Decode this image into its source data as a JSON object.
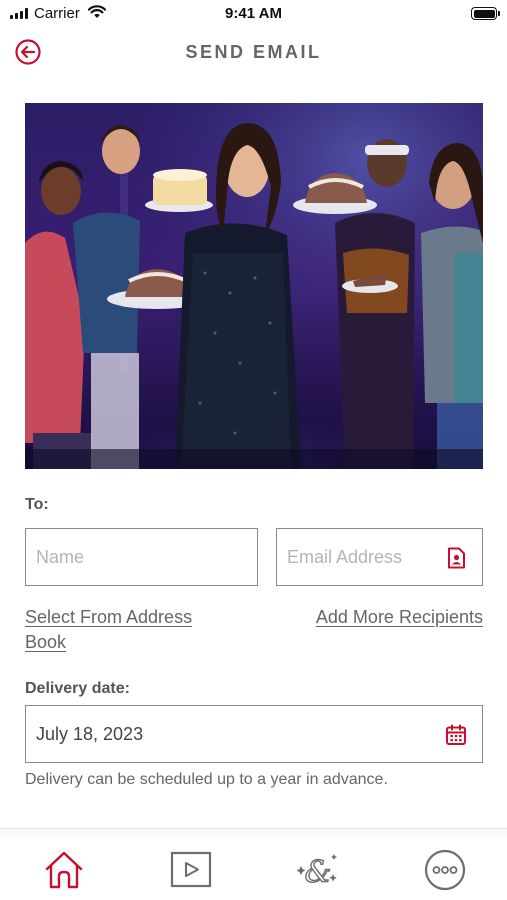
{
  "status_bar": {
    "carrier": "Carrier",
    "time": "9:41 AM"
  },
  "header": {
    "title": "SEND EMAIL",
    "back_icon": "back-arrow-circle-icon"
  },
  "hero": {
    "image": "cast-holding-cakes-photo"
  },
  "form": {
    "to_label": "To:",
    "name_placeholder": "Name",
    "email_placeholder": "Email Address",
    "contact_icon": "contact-card-icon",
    "select_address_book": "Select From Address Book",
    "add_more_recipients": "Add More Recipients",
    "delivery_label": "Delivery date:",
    "delivery_date": "July 18, 2023",
    "calendar_icon": "calendar-icon",
    "delivery_note": "Delivery can be scheduled up to a year in advance."
  },
  "tab_bar": {
    "active": "home",
    "items": [
      {
        "id": "home",
        "icon": "home-icon"
      },
      {
        "id": "video",
        "icon": "play-icon"
      },
      {
        "id": "brand",
        "icon": "ampersand-sparkle-icon"
      },
      {
        "id": "more",
        "icon": "more-icon"
      }
    ]
  },
  "colors": {
    "accent": "#c8102e",
    "icon_gray": "#6e6e6e",
    "title_gray": "#666666",
    "border": "#8a8a8a"
  }
}
